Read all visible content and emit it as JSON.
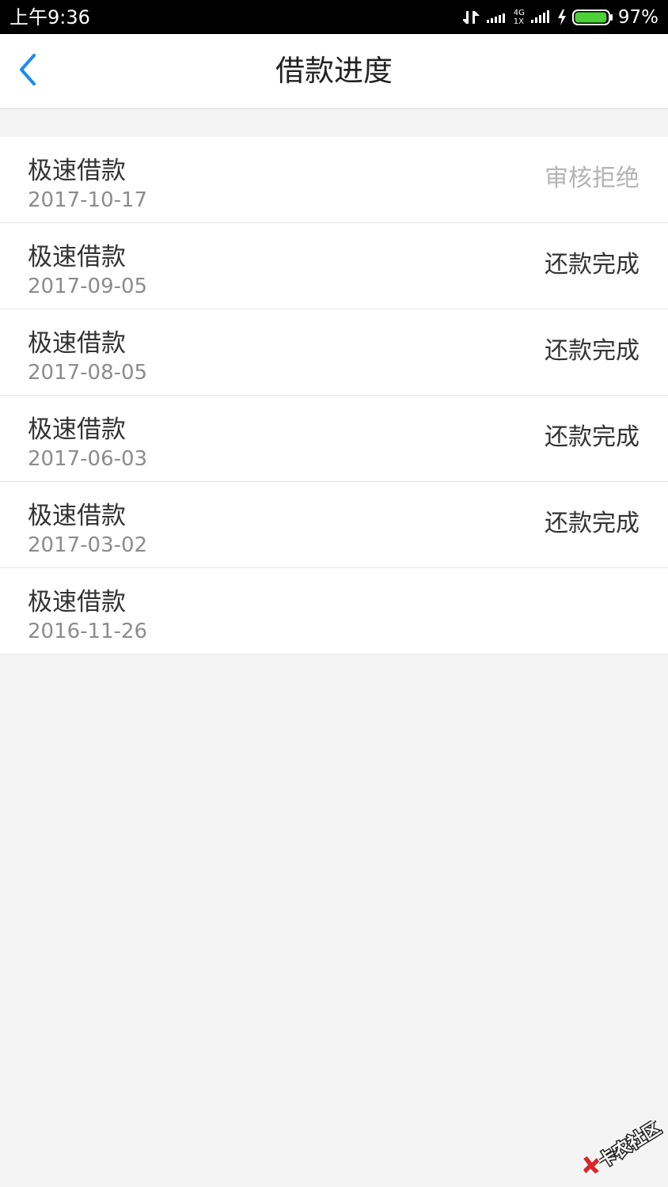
{
  "status_bar": {
    "time": "上午9:36",
    "network_label_top": "4G",
    "network_label_bottom": "1X",
    "battery_percent": "97%",
    "battery_level": 0.97,
    "battery_color": "#4cd137"
  },
  "header": {
    "title": "借款进度",
    "back_icon": "chevron-left-icon",
    "accent_color": "#1a8cf0"
  },
  "loans": [
    {
      "title": "极速借款",
      "date": "2017-10-17",
      "status": "审核拒绝",
      "status_type": "rejected"
    },
    {
      "title": "极速借款",
      "date": "2017-09-05",
      "status": "还款完成",
      "status_type": "completed"
    },
    {
      "title": "极速借款",
      "date": "2017-08-05",
      "status": "还款完成",
      "status_type": "completed"
    },
    {
      "title": "极速借款",
      "date": "2017-06-03",
      "status": "还款完成",
      "status_type": "completed"
    },
    {
      "title": "极速借款",
      "date": "2017-03-02",
      "status": "还款完成",
      "status_type": "completed"
    },
    {
      "title": "极速借款",
      "date": "2016-11-26",
      "status": "",
      "status_type": "none"
    }
  ],
  "watermark": {
    "text": "卡农社区"
  }
}
